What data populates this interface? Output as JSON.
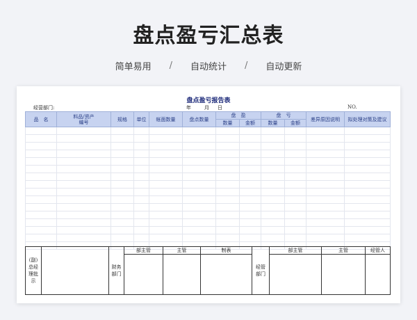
{
  "banner": {
    "title": "盘点盈亏汇总表",
    "taglines": [
      "简单易用",
      "自动统计",
      "自动更新"
    ],
    "separator": "/"
  },
  "report": {
    "title": "盘点盈亏报告表",
    "dept_label": "经营部门:",
    "year": "年",
    "month": "月",
    "day": "日",
    "no_label": "NO.",
    "headers": {
      "name": "品　名",
      "material_line1": "料品/资产",
      "material_line2": "编号",
      "spec": "规格",
      "unit": "单位",
      "book_qty": "帐面数量",
      "count_qty": "盘点数量",
      "surplus": "盘　盈",
      "loss": "盘　亏",
      "qty": "数量",
      "amount": "金额",
      "diff_reason": "差异原因说明",
      "suggestion": "拟处理对策及建议"
    },
    "footer": {
      "gm_approval": "(副)总经理批示",
      "finance_dept": "财务部门",
      "dept_head": "部主管",
      "supervisor": "主管",
      "preparer": "制表",
      "operations_dept": "经管部门",
      "handler": "经管人"
    }
  }
}
